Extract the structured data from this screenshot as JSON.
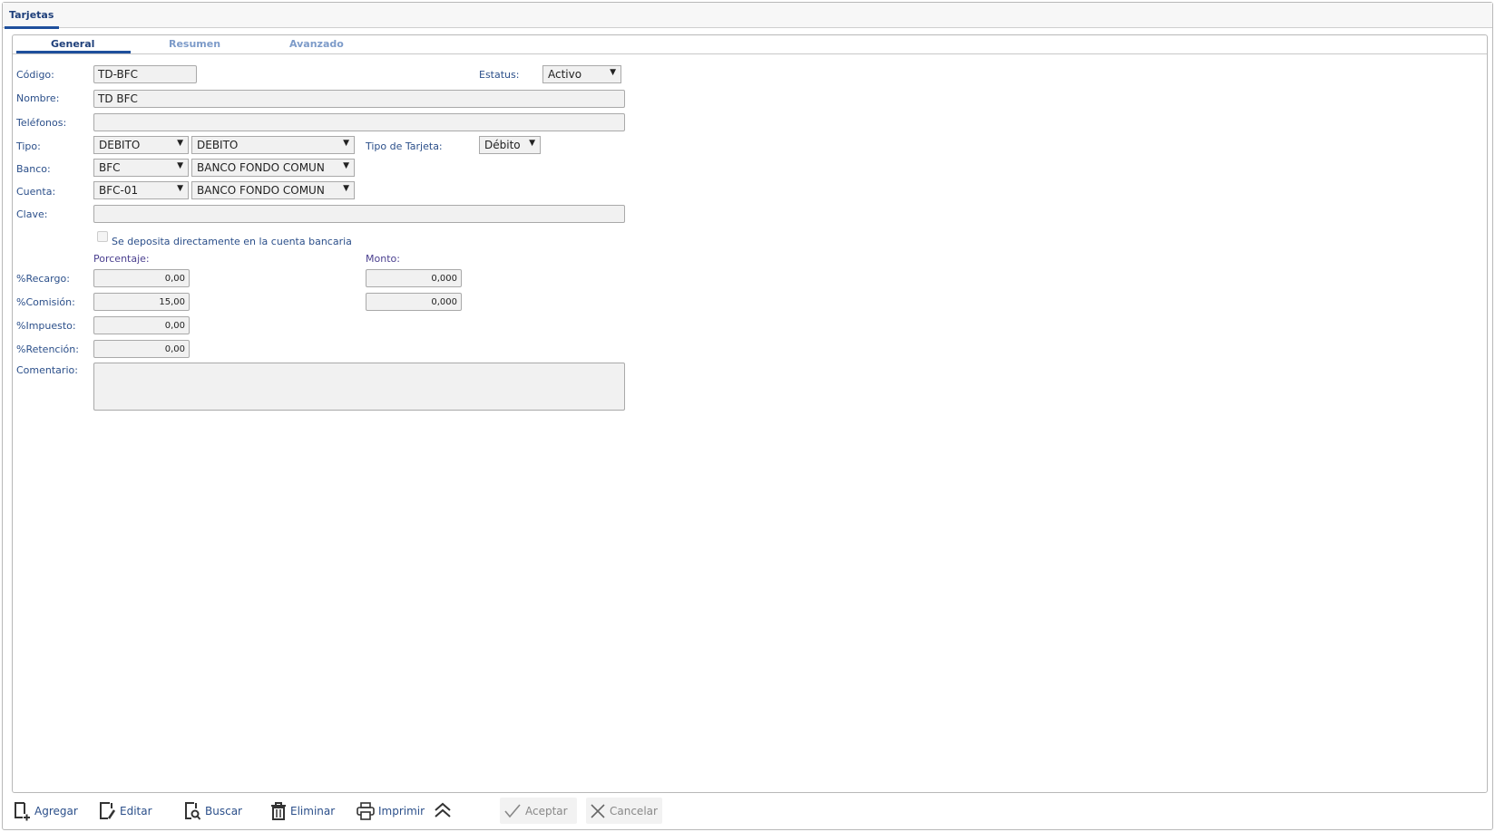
{
  "window": {
    "tab": "Tarjetas"
  },
  "tabs": [
    {
      "label": "General"
    },
    {
      "label": "Resumen"
    },
    {
      "label": "Avanzado"
    }
  ],
  "form": {
    "codigo": {
      "label": "Código:",
      "value": "TD-BFC"
    },
    "estatus": {
      "label": "Estatus:",
      "value": "Activo"
    },
    "nombre": {
      "label": "Nombre:",
      "value": "TD BFC"
    },
    "telefonos": {
      "label": "Teléfonos:",
      "value": ""
    },
    "tipo": {
      "label": "Tipo:",
      "code": "DEBITO",
      "name": "DEBITO"
    },
    "tipo_tarjeta": {
      "label": "Tipo de Tarjeta:",
      "value": "Débito"
    },
    "banco": {
      "label": "Banco:",
      "code": "BFC",
      "name": "BANCO FONDO COMUN"
    },
    "cuenta": {
      "label": "Cuenta:",
      "code": "BFC-01",
      "name": "BANCO FONDO COMUN"
    },
    "clave": {
      "label": "Clave:",
      "value": ""
    },
    "deposita": {
      "label": "Se deposita directamente en la cuenta bancaria",
      "checked": false
    },
    "porcentaje_header": "Porcentaje:",
    "monto_header": "Monto:",
    "recargo": {
      "label": "%Recargo:",
      "pct": "0,00",
      "monto": "0,000"
    },
    "comision": {
      "label": "%Comisión:",
      "pct": "15,00",
      "monto": "0,000"
    },
    "impuesto": {
      "label": "%Impuesto:",
      "pct": "0,00"
    },
    "retencion": {
      "label": "%Retención:",
      "pct": "0,00"
    },
    "comentario": {
      "label": "Comentario:",
      "value": ""
    }
  },
  "toolbar": {
    "agregar": "Agregar",
    "editar": "Editar",
    "buscar": "Buscar",
    "eliminar": "Eliminar",
    "imprimir": "Imprimir",
    "aceptar": "Aceptar",
    "cancelar": "Cancelar"
  }
}
